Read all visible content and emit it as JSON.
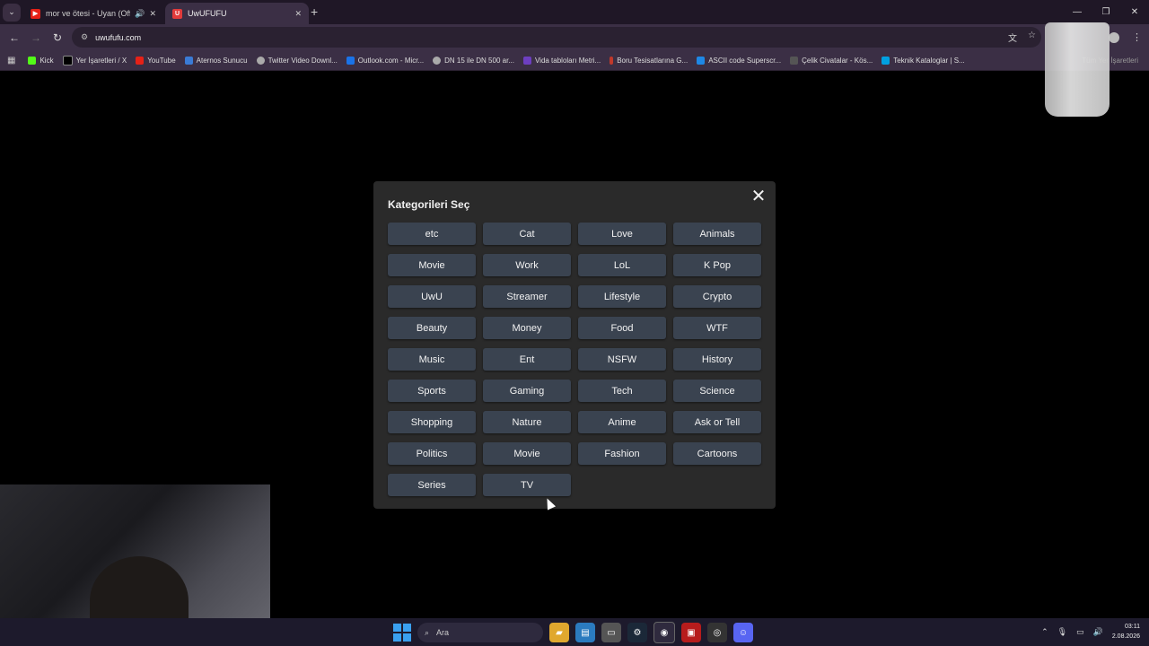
{
  "browser": {
    "tabs": [
      {
        "title": "mor ve ötesi - Uyan (Officia",
        "favicon_color": "#e62117",
        "audio": true
      },
      {
        "title": "UwUFUFU",
        "favicon_color": "#e23b3b",
        "favicon_letter": "U",
        "active": true
      }
    ],
    "url": "uwufufu.com",
    "bookmarks": [
      {
        "label": "Kick",
        "color": "#53fc18"
      },
      {
        "label": "Yer İşaretleri / X",
        "color": "#000000"
      },
      {
        "label": "YouTube",
        "color": "#e62117"
      },
      {
        "label": "Aternos Sunucu",
        "color": "#3a7bd5"
      },
      {
        "label": "Twitter Video Downl...",
        "color": "#aaaaaa"
      },
      {
        "label": "Outlook.com - Micr...",
        "color": "#1a73e8"
      },
      {
        "label": "DN 15 ile DN 500 ar...",
        "color": "#aaaaaa"
      },
      {
        "label": "Vida tabloları Metri...",
        "color": "#6d3fc0"
      },
      {
        "label": "Boru Tesisatlarına G...",
        "color": "#c0392b"
      },
      {
        "label": "ASCII code Superscr...",
        "color": "#1e88e5"
      },
      {
        "label": "Çelik Civatalar - Kös...",
        "color": "#555555"
      },
      {
        "label": "Teknik Kataloglar | S...",
        "color": "#00a0e0"
      }
    ],
    "all_bookmarks": "Tüm Yer İşaretleri"
  },
  "modal": {
    "title": "Kategorileri Seç",
    "close_icon": "close-icon",
    "categories": [
      "etc",
      "Cat",
      "Love",
      "Animals",
      "Movie",
      "Work",
      "LoL",
      "K Pop",
      "UwU",
      "Streamer",
      "Lifestyle",
      "Crypto",
      "Beauty",
      "Money",
      "Food",
      "WTF",
      "Music",
      "Ent",
      "NSFW",
      "History",
      "Sports",
      "Gaming",
      "Tech",
      "Science",
      "Shopping",
      "Nature",
      "Anime",
      "Ask or Tell",
      "Politics",
      "Movie",
      "Fashion",
      "Cartoons",
      "Series",
      "TV"
    ]
  },
  "taskbar": {
    "search_placeholder": "Ara",
    "time": "03:11",
    "date": "2.08.2026"
  }
}
